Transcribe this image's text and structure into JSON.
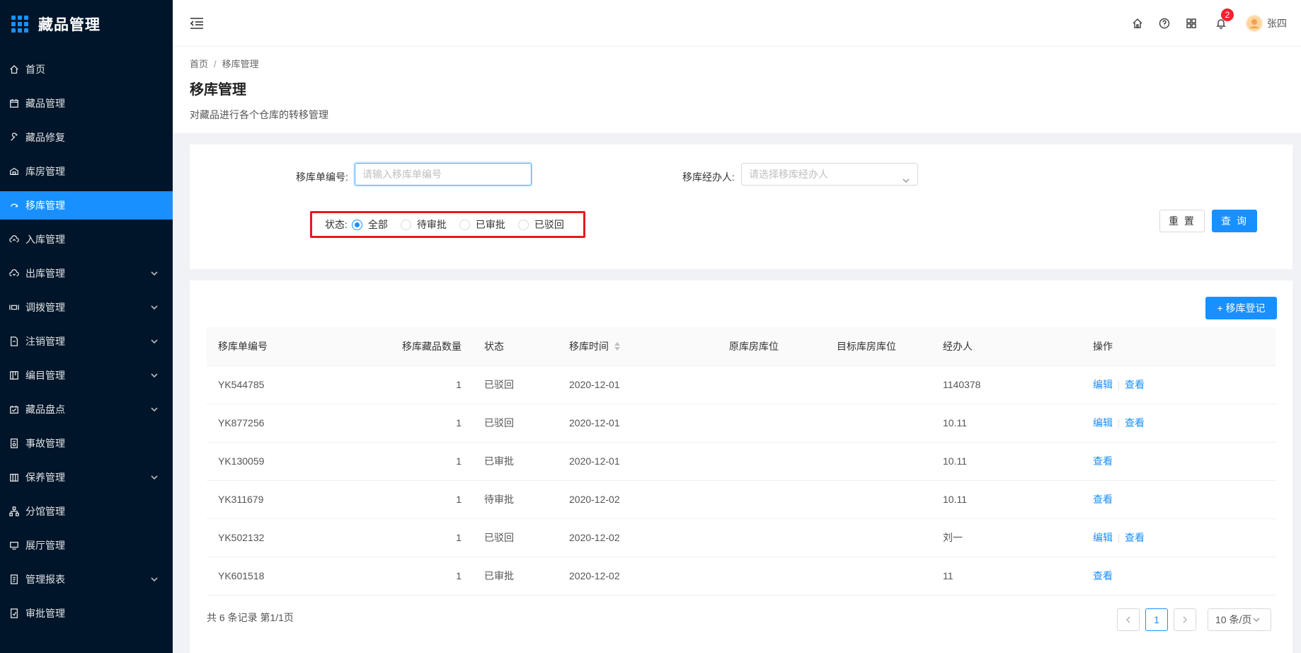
{
  "app": {
    "title": "藏品管理"
  },
  "sidebar": {
    "items": [
      {
        "label": "首页",
        "icon": "home-icon",
        "expandable": false,
        "active": false
      },
      {
        "label": "藏品管理",
        "icon": "calendar-icon",
        "expandable": false,
        "active": false
      },
      {
        "label": "藏品修复",
        "icon": "wrench-icon",
        "expandable": false,
        "active": false
      },
      {
        "label": "库房管理",
        "icon": "warehouse-icon",
        "expandable": false,
        "active": false
      },
      {
        "label": "移库管理",
        "icon": "transfer-icon",
        "expandable": false,
        "active": true
      },
      {
        "label": "入库管理",
        "icon": "upload-cloud-icon",
        "expandable": false,
        "active": false
      },
      {
        "label": "出库管理",
        "icon": "download-cloud-icon",
        "expandable": true,
        "active": false
      },
      {
        "label": "调拨管理",
        "icon": "allocate-icon",
        "expandable": true,
        "active": false
      },
      {
        "label": "注销管理",
        "icon": "file-icon",
        "expandable": true,
        "active": false
      },
      {
        "label": "编目管理",
        "icon": "catalog-icon",
        "expandable": true,
        "active": false
      },
      {
        "label": "藏品盘点",
        "icon": "inventory-icon",
        "expandable": true,
        "active": false
      },
      {
        "label": "事故管理",
        "icon": "accident-icon",
        "expandable": false,
        "active": false
      },
      {
        "label": "保养管理",
        "icon": "maintenance-icon",
        "expandable": true,
        "active": false
      },
      {
        "label": "分馆管理",
        "icon": "branch-icon",
        "expandable": false,
        "active": false
      },
      {
        "label": "展厅管理",
        "icon": "monitor-icon",
        "expandable": false,
        "active": false
      },
      {
        "label": "管理报表",
        "icon": "report-icon",
        "expandable": true,
        "active": false
      },
      {
        "label": "审批管理",
        "icon": "approve-icon",
        "expandable": false,
        "active": false
      }
    ]
  },
  "header": {
    "notification_count": "2",
    "username": "张四"
  },
  "page": {
    "breadcrumb": [
      "首页",
      "移库管理"
    ],
    "title": "移库管理",
    "description": "对藏品进行各个仓库的转移管理"
  },
  "filter": {
    "order_no_label": "移库单编号:",
    "order_no_placeholder": "请输入移库单编号",
    "handler_label": "移库经办人:",
    "handler_placeholder": "请选择移库经办人",
    "status_label": "状态:",
    "status_options": [
      "全部",
      "待审批",
      "已审批",
      "已驳回"
    ],
    "status_selected": "全部",
    "reset_label": "重 置",
    "query_label": "查 询"
  },
  "table": {
    "add_label": "+ 移库登记",
    "columns": [
      "移库单编号",
      "移库藏品数量",
      "状态",
      "移库时间",
      "原库房库位",
      "目标库房库位",
      "经办人",
      "操作"
    ],
    "rows": [
      {
        "code": "YK544785",
        "count": "1",
        "status": "已驳回",
        "time": "2020-12-01",
        "from": "",
        "to": "",
        "handler": "1140378",
        "ops": [
          "编辑",
          "查看"
        ]
      },
      {
        "code": "YK877256",
        "count": "1",
        "status": "已驳回",
        "time": "2020-12-01",
        "from": "",
        "to": "",
        "handler": "10.11",
        "ops": [
          "编辑",
          "查看"
        ]
      },
      {
        "code": "YK130059",
        "count": "1",
        "status": "已审批",
        "time": "2020-12-01",
        "from": "",
        "to": "",
        "handler": "10.11",
        "ops": [
          "查看"
        ]
      },
      {
        "code": "YK311679",
        "count": "1",
        "status": "待审批",
        "time": "2020-12-02",
        "from": "",
        "to": "",
        "handler": "10.11",
        "ops": [
          "查看"
        ]
      },
      {
        "code": "YK502132",
        "count": "1",
        "status": "已驳回",
        "time": "2020-12-02",
        "from": "",
        "to": "",
        "handler": "刘一",
        "ops": [
          "编辑",
          "查看"
        ]
      },
      {
        "code": "YK601518",
        "count": "1",
        "status": "已审批",
        "time": "2020-12-02",
        "from": "",
        "to": "",
        "handler": "11",
        "ops": [
          "查看"
        ]
      }
    ]
  },
  "pagination": {
    "summary": "共 6 条记录 第1/1页",
    "current_page": "1",
    "page_size": "10 条/页"
  },
  "colors": {
    "primary": "#1890ff",
    "sidebar_bg": "#001529",
    "highlight_border": "#e8191d",
    "badge": "#f5222d"
  }
}
